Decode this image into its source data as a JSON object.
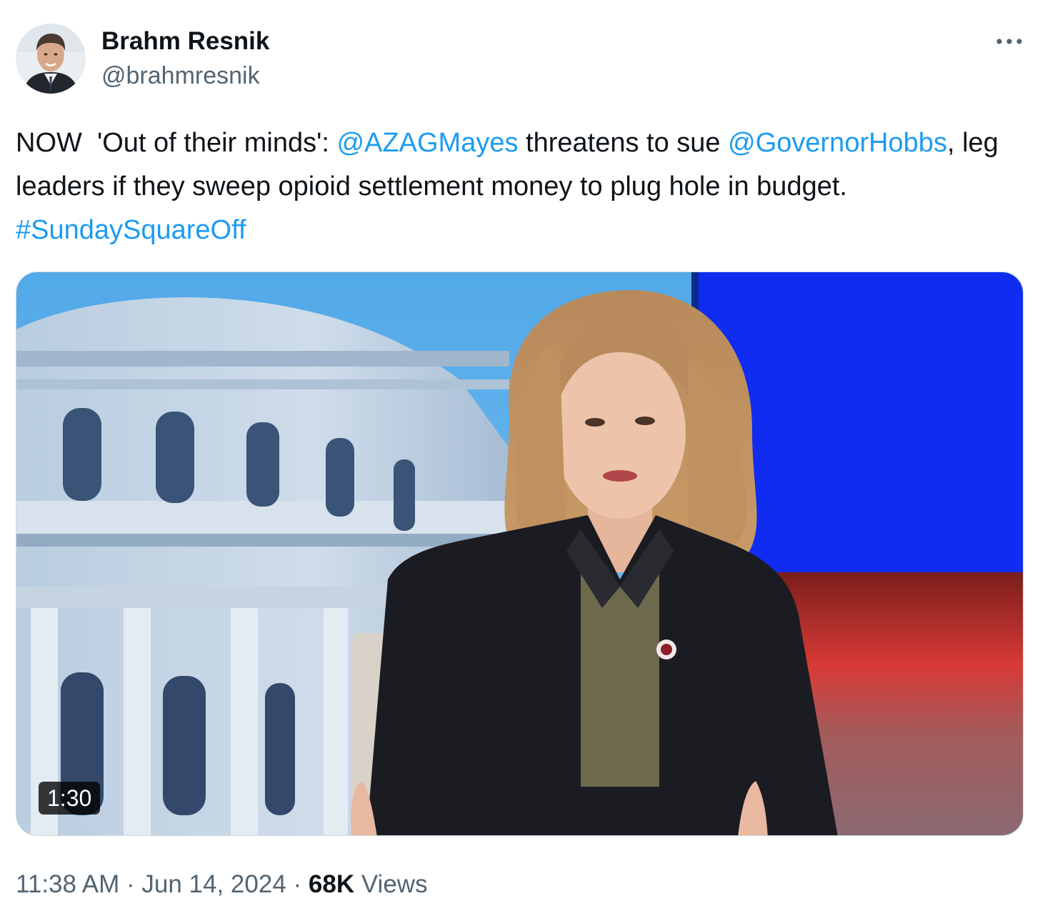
{
  "author": {
    "display_name": "Brahm Resnik",
    "handle": "@brahmresnik",
    "avatar_icon": "profile-photo"
  },
  "more_icon": "more-horizontal-icon",
  "tweet": {
    "prefix": "NOW  'Out of their minds': ",
    "mention1": "@AZAGMayes",
    "text2": " threatens to sue ",
    "mention2": "@GovernorHobbs",
    "text3": ", leg leaders if they sweep opioid settlement money to plug hole in budget. ",
    "hashtag": "#SundaySquareOff"
  },
  "media": {
    "type": "video",
    "duration": "1:30"
  },
  "meta": {
    "time": "11:38 AM",
    "separator1": " · ",
    "date": "Jun 14, 2024",
    "separator2": " · ",
    "views_count": "68K",
    "views_label": " Views"
  },
  "colors": {
    "link": "#1d9bf0",
    "text": "#0f1419",
    "secondary": "#536471"
  }
}
